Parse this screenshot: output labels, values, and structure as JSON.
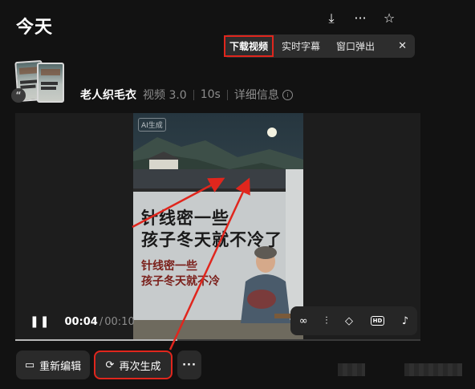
{
  "section_title": "今天",
  "avatar_badge": "“",
  "video": {
    "title": "老人织毛衣",
    "model": "视频 3.0",
    "duration": "10s",
    "details_label": "详细信息",
    "info_icon": "i",
    "ai_badge": "AI生成",
    "caption_large": [
      "针线密一些",
      "孩子冬天就不冷了"
    ],
    "caption_small": [
      "针线密一些",
      "孩子冬天就不冷"
    ]
  },
  "player": {
    "current_time": "00:04",
    "separator": "/",
    "total_time": "00:10",
    "progress": 0.4,
    "play_pause_icon": "❚❚"
  },
  "context_menu": {
    "items": [
      "下载视频",
      "实时字幕",
      "窗口弹出"
    ],
    "close": "✕"
  },
  "top_icons": {
    "download": "⤓",
    "more": "···",
    "favorite": "☆"
  },
  "control_icons": {
    "loop": "∞",
    "audio": "⫶",
    "style": "◇",
    "hd": "HD",
    "music": "♪"
  },
  "actions": {
    "edit_label": "重新编辑",
    "edit_icon": "▭",
    "regenerate_label": "再次生成",
    "regenerate_icon": "⟳",
    "more_label": "···"
  },
  "colors": {
    "highlight": "#e0261d",
    "background": "#121212"
  }
}
